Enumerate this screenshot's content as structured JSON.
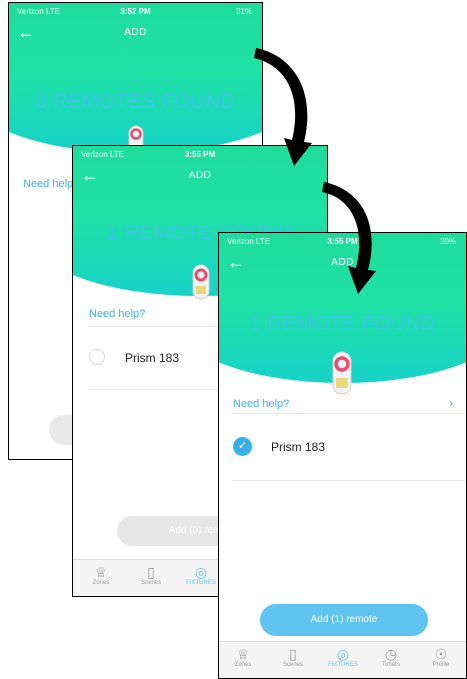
{
  "screen1": {
    "status": {
      "carrier": "Verizon LTE",
      "time": "3:52 PM",
      "battery": "21%"
    },
    "title": "ADD",
    "found": "0 REMOTES FOUND",
    "help": "Need help?"
  },
  "screen2": {
    "status": {
      "carrier": "Verizon LTE",
      "time": "3:55 PM"
    },
    "title": "ADD",
    "found": "1 REMOTE FOUND",
    "help": "Need help?",
    "device": "Prism 183",
    "add_button": "Add (0) remote",
    "tabs": [
      "Zones",
      "Scenes",
      "FIXTURES"
    ]
  },
  "screen3": {
    "status": {
      "carrier": "Verizon LTE",
      "time": "3:55 PM",
      "battery": "20%"
    },
    "title": "ADD",
    "found": "1 REMOTE FOUND",
    "help": "Need help?",
    "device": "Prism 183",
    "add_button": "Add (1) remote",
    "tabs": [
      "Zones",
      "Scenes",
      "FIXTURES",
      "Timers",
      "Profile"
    ]
  },
  "colors": {
    "accent": "#3bb3e6",
    "hero_top": "#1fdc9c",
    "hero_bottom": "#17d2c9",
    "button_active": "#5fc3f0"
  },
  "icons": [
    "back-arrow-icon",
    "chevron-right-icon",
    "check-icon",
    "remote-control-icon",
    "zones-icon",
    "scenes-icon",
    "fixtures-icon",
    "timers-icon",
    "profile-icon"
  ]
}
